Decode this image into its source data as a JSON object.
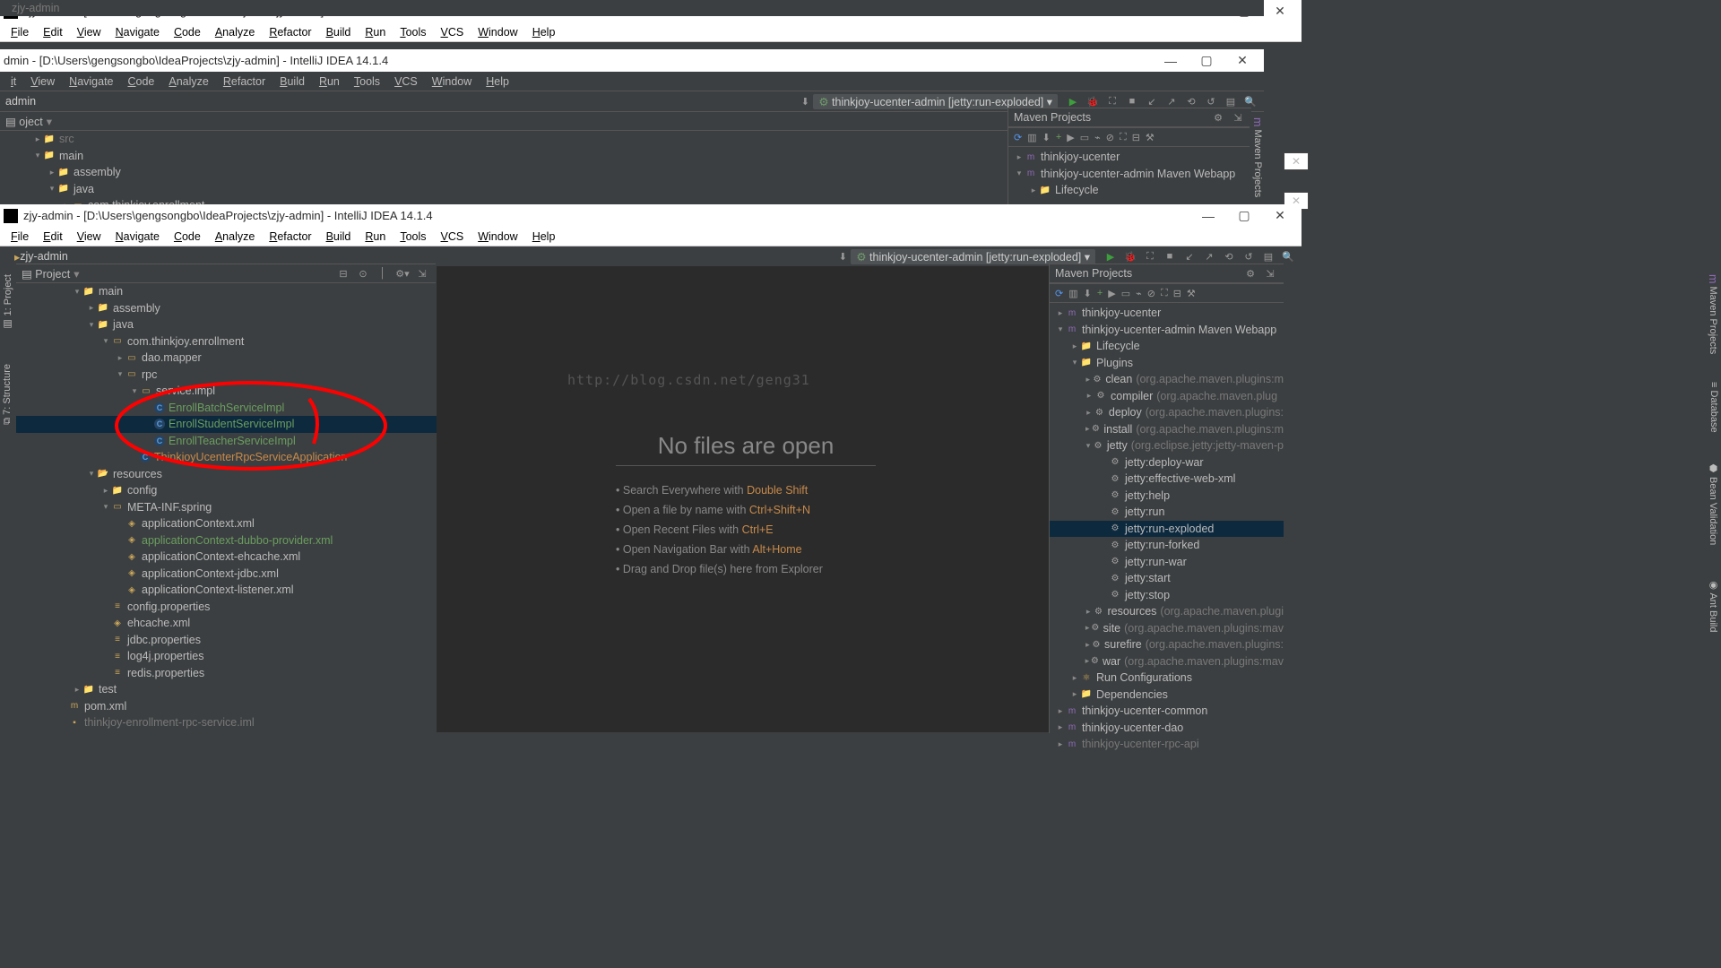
{
  "window_title": "zjy-admin - [D:\\Users\\gengsongbo\\IdeaProjects\\zjy-admin] - IntelliJ IDEA 14.1.4",
  "menus": [
    "File",
    "Edit",
    "View",
    "Navigate",
    "Code",
    "Analyze",
    "Refactor",
    "Build",
    "Run",
    "Tools",
    "VCS",
    "Window",
    "Help"
  ],
  "breadcrumb": "zjy-admin",
  "run_config": "thinkjoy-ucenter-admin [jetty:run-exploded]",
  "project_panel_title": "Project",
  "maven_panel_title": "Maven Projects",
  "watermark_url": "http://blog.csdn.net/geng31",
  "empty_editor": {
    "title": "No files are open",
    "tips": [
      {
        "text": "Search Everywhere with ",
        "kbd": "Double Shift"
      },
      {
        "text": "Open a file by name with ",
        "kbd": "Ctrl+Shift+N"
      },
      {
        "text": "Open Recent Files with ",
        "kbd": "Ctrl+E"
      },
      {
        "text": "Open Navigation Bar with ",
        "kbd": "Alt+Home"
      },
      {
        "text": "Drag and Drop file(s) here from Explorer",
        "kbd": ""
      }
    ]
  },
  "project_tree": [
    {
      "depth": 2,
      "twisty": "▾",
      "icon": "📁",
      "label": "main",
      "cls": ""
    },
    {
      "depth": 3,
      "twisty": "▸",
      "icon": "📁",
      "label": "assembly",
      "cls": ""
    },
    {
      "depth": 3,
      "twisty": "▾",
      "icon": "📁",
      "label": "java",
      "cls": ""
    },
    {
      "depth": 4,
      "twisty": "▾",
      "icon": "▭",
      "label": "com.thinkjoy.enrollment",
      "cls": ""
    },
    {
      "depth": 5,
      "twisty": "▸",
      "icon": "▭",
      "label": "dao.mapper",
      "cls": ""
    },
    {
      "depth": 5,
      "twisty": "▾",
      "icon": "▭",
      "label": "rpc",
      "cls": ""
    },
    {
      "depth": 6,
      "twisty": "▾",
      "icon": "▭",
      "label": "service.impl",
      "cls": ""
    },
    {
      "depth": 7,
      "twisty": "",
      "icon": "C",
      "label": "EnrollBatchServiceImpl",
      "cls": "grn"
    },
    {
      "depth": 7,
      "twisty": "",
      "icon": "C",
      "label": "EnrollStudentServiceImpl",
      "cls": "grn",
      "sel": true
    },
    {
      "depth": 7,
      "twisty": "",
      "icon": "C",
      "label": "EnrollTeacherServiceImpl",
      "cls": "grn"
    },
    {
      "depth": 6,
      "twisty": "",
      "icon": "C",
      "label": "ThinkjoyUcenterRpcServiceApplication",
      "cls": "org"
    },
    {
      "depth": 3,
      "twisty": "▾",
      "icon": "📂",
      "label": "resources",
      "cls": ""
    },
    {
      "depth": 4,
      "twisty": "▸",
      "icon": "📁",
      "label": "config",
      "cls": ""
    },
    {
      "depth": 4,
      "twisty": "▾",
      "icon": "▭",
      "label": "META-INF.spring",
      "cls": ""
    },
    {
      "depth": 5,
      "twisty": "",
      "icon": "◈",
      "label": "applicationContext.xml",
      "cls": ""
    },
    {
      "depth": 5,
      "twisty": "",
      "icon": "◈",
      "label": "applicationContext-dubbo-provider.xml",
      "cls": "grn"
    },
    {
      "depth": 5,
      "twisty": "",
      "icon": "◈",
      "label": "applicationContext-ehcache.xml",
      "cls": ""
    },
    {
      "depth": 5,
      "twisty": "",
      "icon": "◈",
      "label": "applicationContext-jdbc.xml",
      "cls": ""
    },
    {
      "depth": 5,
      "twisty": "",
      "icon": "◈",
      "label": "applicationContext-listener.xml",
      "cls": ""
    },
    {
      "depth": 4,
      "twisty": "",
      "icon": "≡",
      "label": "config.properties",
      "cls": ""
    },
    {
      "depth": 4,
      "twisty": "",
      "icon": "◈",
      "label": "ehcache.xml",
      "cls": ""
    },
    {
      "depth": 4,
      "twisty": "",
      "icon": "≡",
      "label": "jdbc.properties",
      "cls": ""
    },
    {
      "depth": 4,
      "twisty": "",
      "icon": "≡",
      "label": "log4j.properties",
      "cls": ""
    },
    {
      "depth": 4,
      "twisty": "",
      "icon": "≡",
      "label": "redis.properties",
      "cls": ""
    },
    {
      "depth": 2,
      "twisty": "▸",
      "icon": "📁",
      "label": "test",
      "cls": ""
    },
    {
      "depth": 1,
      "twisty": "",
      "icon": "m",
      "label": "pom.xml",
      "cls": ""
    },
    {
      "depth": 1,
      "twisty": "",
      "icon": "▪",
      "label": "thinkjoy-enrollment-rpc-service.iml",
      "cls": "dim"
    }
  ],
  "project_tree_partial": [
    {
      "depth": 1,
      "twisty": "▸",
      "icon": "📁",
      "label": "src",
      "cls": "dim"
    },
    {
      "depth": 1,
      "twisty": "▾",
      "icon": "📁",
      "label": "main",
      "cls": ""
    },
    {
      "depth": 2,
      "twisty": "▸",
      "icon": "📁",
      "label": "assembly",
      "cls": ""
    },
    {
      "depth": 2,
      "twisty": "▾",
      "icon": "📁",
      "label": "java",
      "cls": ""
    },
    {
      "depth": 3,
      "twisty": "▸",
      "icon": "▭",
      "label": "com.thinkjoy.enrollment",
      "cls": ""
    }
  ],
  "maven_tree": [
    {
      "depth": 0,
      "twisty": "▸",
      "icon": "m",
      "label": "thinkjoy-ucenter",
      "hint": "",
      "cls": ""
    },
    {
      "depth": 0,
      "twisty": "▾",
      "icon": "m",
      "label": "thinkjoy-ucenter-admin Maven Webapp",
      "hint": "",
      "cls": ""
    },
    {
      "depth": 1,
      "twisty": "▸",
      "icon": "📁",
      "label": "Lifecycle",
      "hint": "",
      "cls": ""
    },
    {
      "depth": 1,
      "twisty": "▾",
      "icon": "📁",
      "label": "Plugins",
      "hint": "",
      "cls": ""
    },
    {
      "depth": 2,
      "twisty": "▸",
      "icon": "⚙",
      "label": "clean",
      "hint": "(org.apache.maven.plugins:m",
      "cls": ""
    },
    {
      "depth": 2,
      "twisty": "▸",
      "icon": "⚙",
      "label": "compiler",
      "hint": "(org.apache.maven.plug",
      "cls": ""
    },
    {
      "depth": 2,
      "twisty": "▸",
      "icon": "⚙",
      "label": "deploy",
      "hint": "(org.apache.maven.plugins:",
      "cls": ""
    },
    {
      "depth": 2,
      "twisty": "▸",
      "icon": "⚙",
      "label": "install",
      "hint": "(org.apache.maven.plugins:m",
      "cls": ""
    },
    {
      "depth": 2,
      "twisty": "▾",
      "icon": "⚙",
      "label": "jetty",
      "hint": "(org.eclipse.jetty:jetty-maven-p",
      "cls": ""
    },
    {
      "depth": 3,
      "twisty": "",
      "icon": "⚙",
      "label": "jetty:deploy-war",
      "hint": "",
      "cls": ""
    },
    {
      "depth": 3,
      "twisty": "",
      "icon": "⚙",
      "label": "jetty:effective-web-xml",
      "hint": "",
      "cls": ""
    },
    {
      "depth": 3,
      "twisty": "",
      "icon": "⚙",
      "label": "jetty:help",
      "hint": "",
      "cls": ""
    },
    {
      "depth": 3,
      "twisty": "",
      "icon": "⚙",
      "label": "jetty:run",
      "hint": "",
      "cls": ""
    },
    {
      "depth": 3,
      "twisty": "",
      "icon": "⚙",
      "label": "jetty:run-exploded",
      "hint": "",
      "cls": "",
      "sel": true
    },
    {
      "depth": 3,
      "twisty": "",
      "icon": "⚙",
      "label": "jetty:run-forked",
      "hint": "",
      "cls": ""
    },
    {
      "depth": 3,
      "twisty": "",
      "icon": "⚙",
      "label": "jetty:run-war",
      "hint": "",
      "cls": ""
    },
    {
      "depth": 3,
      "twisty": "",
      "icon": "⚙",
      "label": "jetty:start",
      "hint": "",
      "cls": ""
    },
    {
      "depth": 3,
      "twisty": "",
      "icon": "⚙",
      "label": "jetty:stop",
      "hint": "",
      "cls": ""
    },
    {
      "depth": 2,
      "twisty": "▸",
      "icon": "⚙",
      "label": "resources",
      "hint": "(org.apache.maven.plugi",
      "cls": ""
    },
    {
      "depth": 2,
      "twisty": "▸",
      "icon": "⚙",
      "label": "site",
      "hint": "(org.apache.maven.plugins:mav",
      "cls": ""
    },
    {
      "depth": 2,
      "twisty": "▸",
      "icon": "⚙",
      "label": "surefire",
      "hint": "(org.apache.maven.plugins:",
      "cls": ""
    },
    {
      "depth": 2,
      "twisty": "▸",
      "icon": "⚙",
      "label": "war",
      "hint": "(org.apache.maven.plugins:mav",
      "cls": ""
    },
    {
      "depth": 1,
      "twisty": "▸",
      "icon": "⚛",
      "label": "Run Configurations",
      "hint": "",
      "cls": ""
    },
    {
      "depth": 1,
      "twisty": "▸",
      "icon": "📁",
      "label": "Dependencies",
      "hint": "",
      "cls": ""
    },
    {
      "depth": 0,
      "twisty": "▸",
      "icon": "m",
      "label": "thinkjoy-ucenter-common",
      "hint": "",
      "cls": ""
    },
    {
      "depth": 0,
      "twisty": "▸",
      "icon": "m",
      "label": "thinkjoy-ucenter-dao",
      "hint": "",
      "cls": ""
    },
    {
      "depth": 0,
      "twisty": "▸",
      "icon": "m",
      "label": "thinkjoy-ucenter-rpc-api",
      "hint": "",
      "cls": "dim"
    }
  ],
  "maven_tree_partial": [
    {
      "depth": 0,
      "twisty": "▸",
      "icon": "m",
      "label": "thinkjoy-ucenter",
      "hint": "",
      "cls": ""
    },
    {
      "depth": 0,
      "twisty": "▾",
      "icon": "m",
      "label": "thinkjoy-ucenter-admin Maven Webapp",
      "hint": "",
      "cls": ""
    },
    {
      "depth": 1,
      "twisty": "▸",
      "icon": "📁",
      "label": "Lifecycle",
      "hint": "",
      "cls": ""
    }
  ],
  "partial_title2": "dmin - [D:\\Users\\gengsongbo\\IdeaProjects\\zjy-admin] - IntelliJ IDEA 14.1.4",
  "partial_menu2": [
    "it",
    "View",
    "Navigate",
    "Code",
    "Analyze",
    "Refactor",
    "Build",
    "Run",
    "Tools",
    "VCS",
    "Window",
    "Help"
  ],
  "partial_crumb2": "admin",
  "partial_proj2": "oject"
}
